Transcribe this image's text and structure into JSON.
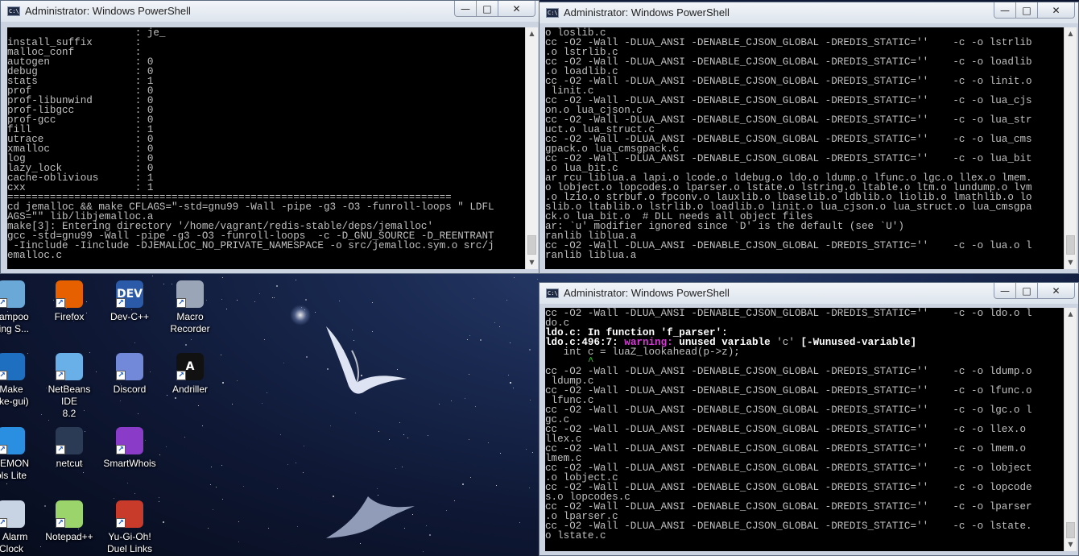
{
  "windows": [
    {
      "title": "Administrator: Windows PowerShell",
      "lines": [
        "                     : je_",
        "install_suffix       :",
        "malloc_conf          :",
        "autogen              : 0",
        "debug                : 0",
        "stats                : 1",
        "prof                 : 0",
        "prof-libunwind       : 0",
        "prof-libgcc          : 0",
        "prof-gcc             : 0",
        "fill                 : 1",
        "utrace               : 0",
        "xmalloc              : 0",
        "log                  : 0",
        "lazy_lock            : 0",
        "cache-oblivious      : 1",
        "cxx                  : 1",
        "=========================================================================",
        "cd jemalloc && make CFLAGS=\"-std=gnu99 -Wall -pipe -g3 -O3 -funroll-loops \" LDFL",
        "AGS=\"\" lib/libjemalloc.a",
        "make[3]: Entering directory '/home/vagrant/redis-stable/deps/jemalloc'",
        "gcc -std=gnu99 -Wall -pipe -g3 -O3 -funroll-loops  -c -D_GNU_SOURCE -D_REENTRANT",
        " -Iinclude -Iinclude -DJEMALLOC_NO_PRIVATE_NAMESPACE -o src/jemalloc.sym.o src/j",
        "emalloc.c"
      ]
    },
    {
      "title": "Administrator: Windows PowerShell",
      "lines": [
        "o loslib.c",
        "cc -O2 -Wall -DLUA_ANSI -DENABLE_CJSON_GLOBAL -DREDIS_STATIC=''    -c -o lstrlib",
        ".o lstrlib.c",
        "cc -O2 -Wall -DLUA_ANSI -DENABLE_CJSON_GLOBAL -DREDIS_STATIC=''    -c -o loadlib",
        ".o loadlib.c",
        "cc -O2 -Wall -DLUA_ANSI -DENABLE_CJSON_GLOBAL -DREDIS_STATIC=''    -c -o linit.o",
        " linit.c",
        "cc -O2 -Wall -DLUA_ANSI -DENABLE_CJSON_GLOBAL -DREDIS_STATIC=''    -c -o lua_cjs",
        "on.o lua_cjson.c",
        "cc -O2 -Wall -DLUA_ANSI -DENABLE_CJSON_GLOBAL -DREDIS_STATIC=''    -c -o lua_str",
        "uct.o lua_struct.c",
        "cc -O2 -Wall -DLUA_ANSI -DENABLE_CJSON_GLOBAL -DREDIS_STATIC=''    -c -o lua_cms",
        "gpack.o lua_cmsgpack.c",
        "cc -O2 -Wall -DLUA_ANSI -DENABLE_CJSON_GLOBAL -DREDIS_STATIC=''    -c -o lua_bit",
        ".o lua_bit.c",
        "ar rcu liblua.a lapi.o lcode.o ldebug.o ldo.o ldump.o lfunc.o lgc.o llex.o lmem.",
        "o lobject.o lopcodes.o lparser.o lstate.o lstring.o ltable.o ltm.o lundump.o lvm",
        ".o lzio.o strbuf.o fpconv.o lauxlib.o lbaselib.o ldblib.o liolib.o lmathlib.o lo",
        "slib.o ltablib.o lstrlib.o loadlib.o linit.o lua_cjson.o lua_struct.o lua_cmsgpa",
        "ck.o lua_bit.o  # DLL needs all object files",
        "ar: `u' modifier ignored since `D' is the default (see `U')",
        "ranlib liblua.a",
        "cc -O2 -Wall -DLUA_ANSI -DENABLE_CJSON_GLOBAL -DREDIS_STATIC=''    -c -o lua.o l",
        "ranlib liblua.a"
      ]
    },
    {
      "title": "Administrator: Windows PowerShell",
      "lines": [
        "cc -O2 -Wall -DLUA_ANSI -DENABLE_CJSON_GLOBAL -DREDIS_STATIC=''    -c -o ldo.o l",
        "do.c",
        "ldo.c: In function 'f_parser':",
        "ldo.c:496:7: warning: unused variable 'c' [-Wunused-variable]",
        "   int c = luaZ_lookahead(p->z);",
        "       ^",
        "cc -O2 -Wall -DLUA_ANSI -DENABLE_CJSON_GLOBAL -DREDIS_STATIC=''    -c -o ldump.o",
        " ldump.c",
        "cc -O2 -Wall -DLUA_ANSI -DENABLE_CJSON_GLOBAL -DREDIS_STATIC=''    -c -o lfunc.o",
        " lfunc.c",
        "cc -O2 -Wall -DLUA_ANSI -DENABLE_CJSON_GLOBAL -DREDIS_STATIC=''    -c -o lgc.o l",
        "gc.c",
        "cc -O2 -Wall -DLUA_ANSI -DENABLE_CJSON_GLOBAL -DREDIS_STATIC=''    -c -o llex.o",
        "llex.c",
        "cc -O2 -Wall -DLUA_ANSI -DENABLE_CJSON_GLOBAL -DREDIS_STATIC=''    -c -o lmem.o",
        "lmem.c",
        "cc -O2 -Wall -DLUA_ANSI -DENABLE_CJSON_GLOBAL -DREDIS_STATIC=''    -c -o lobject",
        ".o lobject.c",
        "cc -O2 -Wall -DLUA_ANSI -DENABLE_CJSON_GLOBAL -DREDIS_STATIC=''    -c -o lopcode",
        "s.o lopcodes.c",
        "cc -O2 -Wall -DLUA_ANSI -DENABLE_CJSON_GLOBAL -DREDIS_STATIC=''    -c -o lparser",
        ".o lparser.c",
        "cc -O2 -Wall -DLUA_ANSI -DENABLE_CJSON_GLOBAL -DREDIS_STATIC=''    -c -o lstate.",
        "o lstate.c"
      ]
    }
  ],
  "desktop_icons": [
    {
      "label": "hampoo\nning S...",
      "icon": "shampoo-icon",
      "color": "#6aa8d8"
    },
    {
      "label": "Firefox",
      "icon": "firefox-icon",
      "color": "#e66000"
    },
    {
      "label": "Dev-C++",
      "icon": "devcpp-icon",
      "color": "#2a5aa8",
      "text": "DEV"
    },
    {
      "label": "Macro\nRecorder",
      "icon": "macro-recorder-icon",
      "color": "#9aa6b8"
    },
    {
      "label": "Make\nake-gui)",
      "icon": "cmake-icon",
      "color": "#1f6fc0"
    },
    {
      "label": "NetBeans IDE\n8.2",
      "icon": "netbeans-icon",
      "color": "#6ab0e8"
    },
    {
      "label": "Discord",
      "icon": "discord-icon",
      "color": "#7289da"
    },
    {
      "label": "Andriller",
      "icon": "andriller-icon",
      "color": "#111111",
      "text": "A"
    },
    {
      "label": "AEMON\nols Lite",
      "icon": "daemon-tools-icon",
      "color": "#2a8fe0"
    },
    {
      "label": "netcut",
      "icon": "netcut-icon",
      "color": "#2b3a55"
    },
    {
      "label": "SmartWhois",
      "icon": "smartwhois-icon",
      "color": "#8a3cc8"
    },
    {
      "label": "e Alarm\nClock",
      "icon": "alarm-clock-icon",
      "color": "#c8d4e4"
    },
    {
      "label": "Notepad++",
      "icon": "notepadpp-icon",
      "color": "#9bd46a"
    },
    {
      "label": "Yu-Gi-Oh!\nDuel Links",
      "icon": "yugioh-icon",
      "color": "#c83a2a"
    }
  ],
  "buttons": {
    "minimize": "—",
    "maximize": "□",
    "close": "✕"
  },
  "colors": {
    "console_bg": "#000000",
    "console_fg": "#c0c0c0",
    "warning": "#d23ad2",
    "caret": "#2fd12f"
  }
}
